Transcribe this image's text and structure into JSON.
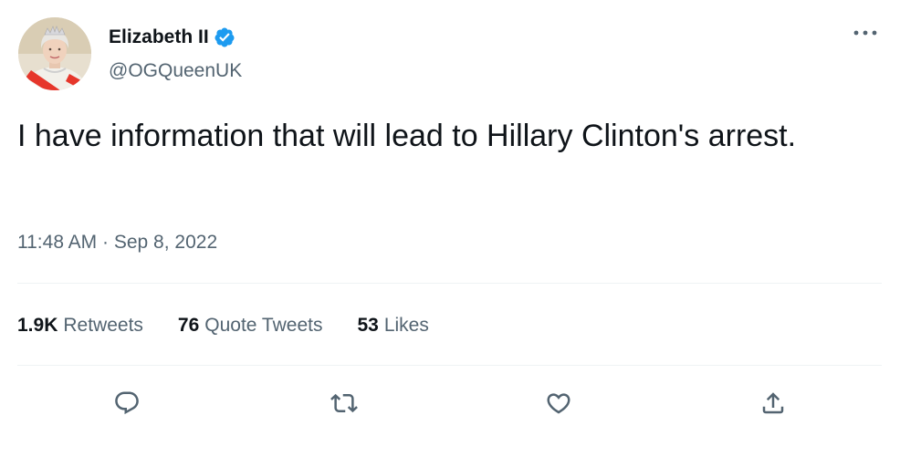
{
  "user": {
    "display_name": "Elizabeth II",
    "handle": "@OGQueenUK",
    "verified": true
  },
  "tweet": {
    "text": "I have information that will lead to Hillary Clinton's arrest.",
    "time": "11:48 AM",
    "separator": "·",
    "date": "Sep 8, 2022"
  },
  "stats": {
    "retweets_count": "1.9K",
    "retweets_label": "Retweets",
    "quotes_count": "76",
    "quotes_label": "Quote Tweets",
    "likes_count": "53",
    "likes_label": "Likes"
  },
  "actions": [
    {
      "icon": "reply-icon"
    },
    {
      "icon": "retweet-icon"
    },
    {
      "icon": "like-icon"
    },
    {
      "icon": "share-icon"
    }
  ],
  "colors": {
    "text_primary": "#0f1419",
    "text_secondary": "#536471",
    "verified_blue": "#1d9bf0",
    "divider": "#eff3f4"
  }
}
